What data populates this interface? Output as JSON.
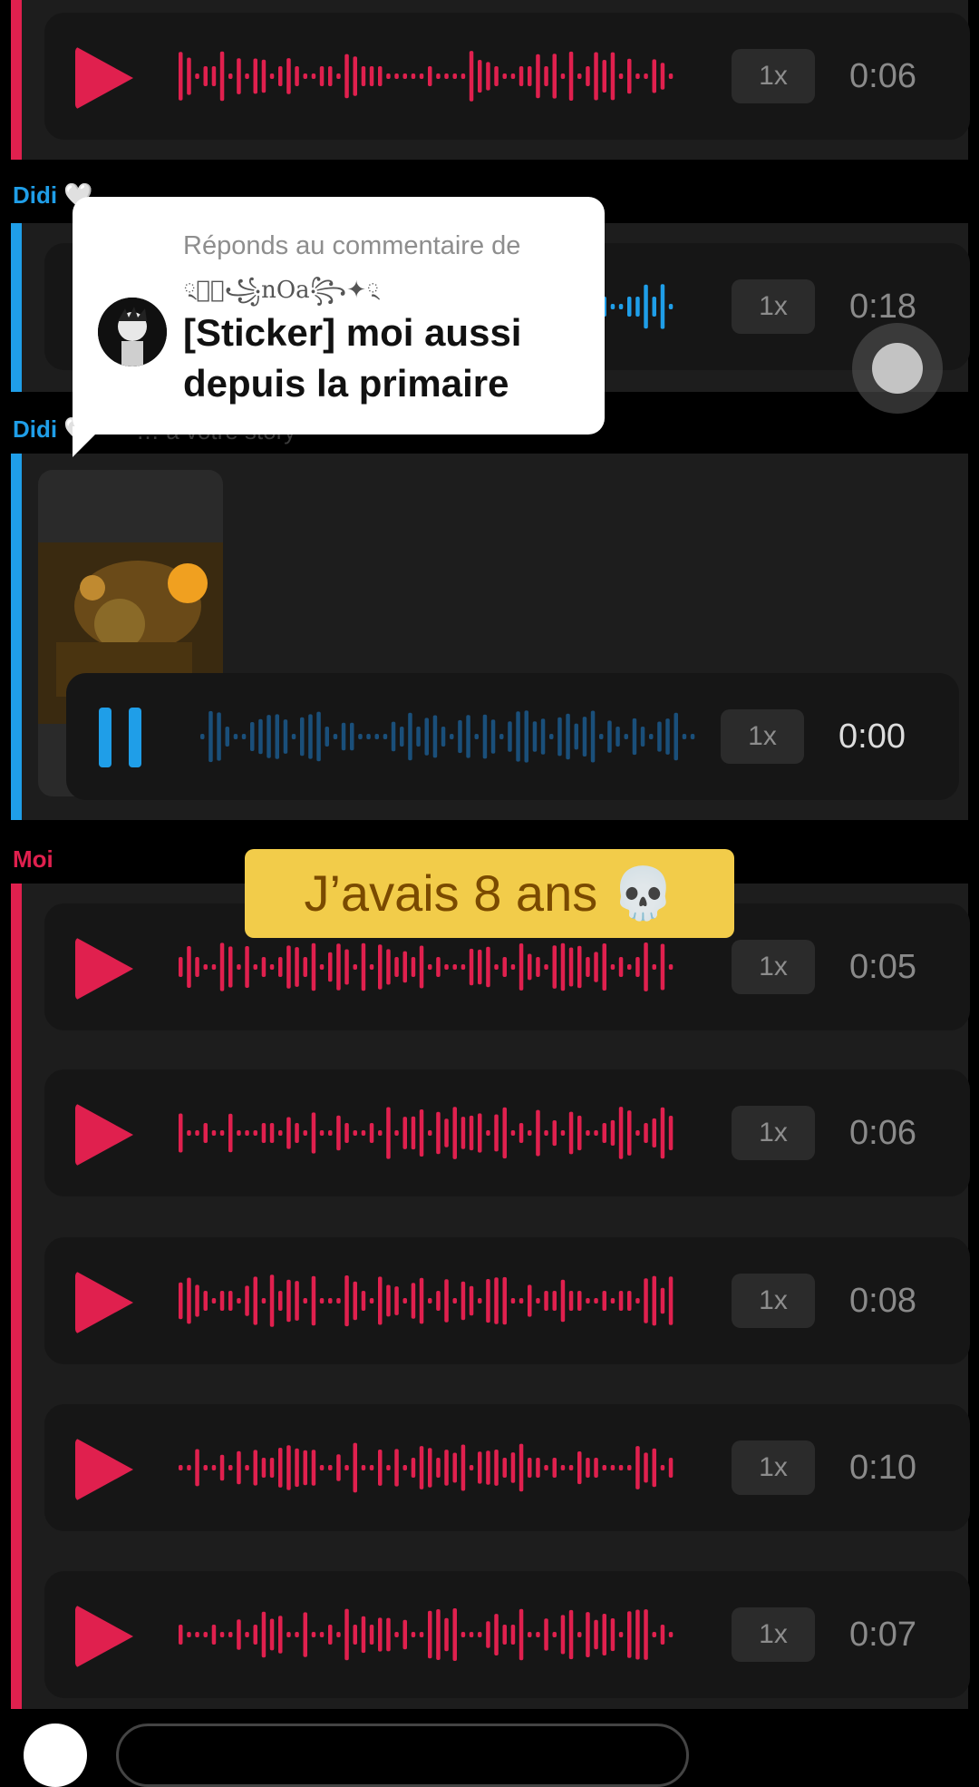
{
  "colors": {
    "me": "#e0204e",
    "other": "#1f9ee8",
    "caption_bg": "#f2cc4a"
  },
  "senders": {
    "didi_1": "Didi",
    "didi_2": "Didi",
    "me": "Moi",
    "heart_icon": "white-heart-icon"
  },
  "faded_reply_text": "… à votre story",
  "messages": [
    {
      "id": "m1",
      "sender": "me",
      "speed": "1x",
      "duration": "0:06",
      "state": "play"
    },
    {
      "id": "m2",
      "sender": "other",
      "speed": "1x",
      "duration": "0:18",
      "state": "play"
    },
    {
      "id": "m3",
      "sender": "other",
      "speed": "1x",
      "duration": "0:00",
      "state": "pause"
    },
    {
      "id": "m4",
      "sender": "me",
      "speed": "1x",
      "duration": "0:05",
      "state": "play"
    },
    {
      "id": "m5",
      "sender": "me",
      "speed": "1x",
      "duration": "0:06",
      "state": "play"
    },
    {
      "id": "m6",
      "sender": "me",
      "speed": "1x",
      "duration": "0:08",
      "state": "play"
    },
    {
      "id": "m7",
      "sender": "me",
      "speed": "1x",
      "duration": "0:10",
      "state": "play"
    },
    {
      "id": "m8",
      "sender": "me",
      "speed": "1x",
      "duration": "0:07",
      "state": "play"
    }
  ],
  "reply_popup": {
    "header": "Réponds au commentaire de",
    "username": "྄✦ེ꧁nOa꧂✦྄",
    "comment": "[Sticker] moi aussi depuis la primaire"
  },
  "caption": {
    "text": "J’avais 8 ans",
    "emoji": "💀"
  }
}
